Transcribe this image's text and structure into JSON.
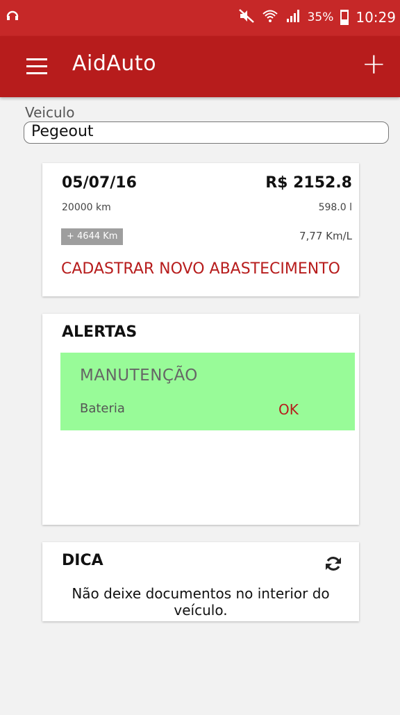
{
  "status": {
    "battery": "35%",
    "time": "10:29"
  },
  "appbar": {
    "title": "AidAuto",
    "add_label": "+"
  },
  "vehicle": {
    "label": "Veiculo",
    "selected": "Pegeout"
  },
  "refuel_card": {
    "date": "05/07/16",
    "price": "R$ 2152.8",
    "odometer": "20000 km",
    "liters": "598.0 l",
    "distance_badge": "+ 4644 Km",
    "efficiency": "7,77 Km/L",
    "action_label": "CADASTRAR NOVO ABASTECIMENTO"
  },
  "alerts_card": {
    "title": "ALERTAS",
    "alert": {
      "type": "MANUTENÇÃO",
      "item": "Bateria",
      "action": "OK",
      "color": "#98fb98"
    }
  },
  "tip_card": {
    "title": "DICA",
    "text": "Não deixe documentos no interior do veículo."
  },
  "colors": {
    "statusbar": "#c62828",
    "appbar": "#b71c1c",
    "accent": "#b71c1c"
  }
}
